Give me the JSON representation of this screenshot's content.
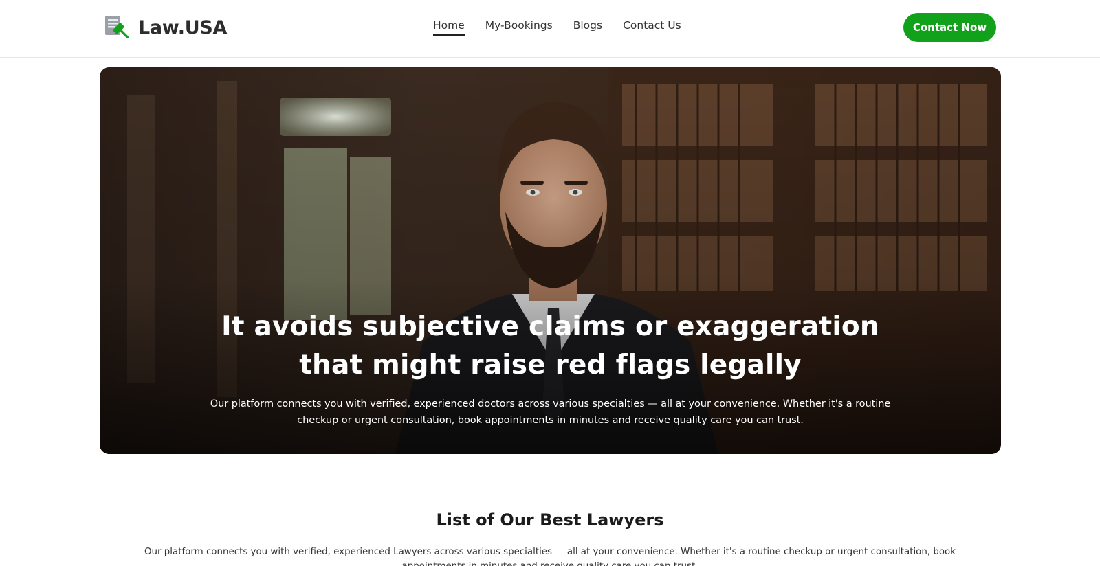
{
  "header": {
    "logo_text": "Law.USA",
    "logo_icon": "gavel-document-icon",
    "nav": [
      {
        "label": "Home",
        "active": true
      },
      {
        "label": "My-Bookings",
        "active": false
      },
      {
        "label": "Blogs",
        "active": false
      },
      {
        "label": "Contact Us",
        "active": false
      }
    ],
    "cta_label": "Contact Now"
  },
  "hero": {
    "image": "lawyer-portrait-in-library",
    "title": "It avoids subjective claims or exaggeration that might raise red flags legally",
    "subtitle": "Our platform connects you with verified, experienced doctors across various specialties — all at your convenience. Whether it's a routine checkup or urgent consultation, book appointments in minutes and receive quality care you can trust."
  },
  "lawyers_section": {
    "title": "List of Our Best Lawyers",
    "subtitle": "Our platform connects you with verified, experienced Lawyers across various specialties — all at your convenience. Whether it's a routine checkup or urgent consultation, book appointments in minutes and receive quality care you can trust."
  },
  "colors": {
    "brand_green": "#11a11a",
    "text_dark": "#2d2d2d"
  }
}
